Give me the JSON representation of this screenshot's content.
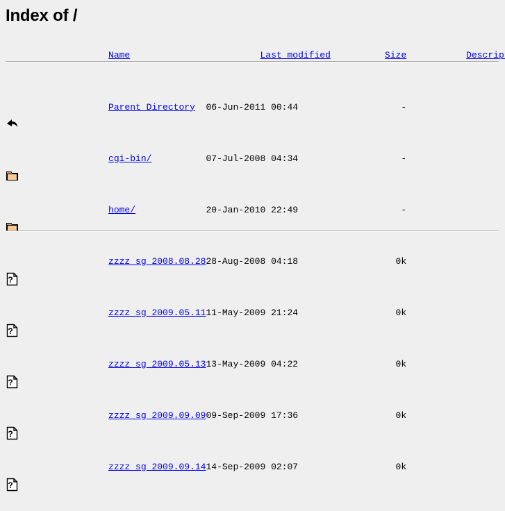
{
  "page": {
    "title": "Index of /"
  },
  "columns": {
    "name": "Name",
    "last_modified": "Last modified",
    "size": "Size",
    "description": "Description"
  },
  "rows": [
    {
      "icon": "back-arrow-icon",
      "name": "Parent Directory",
      "last_modified": "06-Jun-2011 00:44",
      "size": "-",
      "description": ""
    },
    {
      "icon": "folder-icon",
      "name": "cgi-bin/",
      "last_modified": "07-Jul-2008 04:34",
      "size": "-",
      "description": ""
    },
    {
      "icon": "folder-icon",
      "name": "home/",
      "last_modified": "20-Jan-2010 22:49",
      "size": "-",
      "description": ""
    },
    {
      "icon": "unknown-file-icon",
      "name": "zzzz_sg_2008.08.28",
      "last_modified": "28-Aug-2008 04:18",
      "size": "0k",
      "description": ""
    },
    {
      "icon": "unknown-file-icon",
      "name": "zzzz_sg_2009.05.11",
      "last_modified": "11-May-2009 21:24",
      "size": "0k",
      "description": ""
    },
    {
      "icon": "unknown-file-icon",
      "name": "zzzz_sg_2009.05.13",
      "last_modified": "13-May-2009 04:22",
      "size": "0k",
      "description": ""
    },
    {
      "icon": "unknown-file-icon",
      "name": "zzzz_sg_2009.09.09",
      "last_modified": "09-Sep-2009 17:36",
      "size": "0k",
      "description": ""
    },
    {
      "icon": "unknown-file-icon",
      "name": "zzzz_sg_2009.09.14",
      "last_modified": "14-Sep-2009 02:07",
      "size": "0k",
      "description": ""
    }
  ],
  "colors": {
    "background": "#efefef",
    "link": "#0000ee",
    "text": "#000000",
    "rule": "#aaaaaa",
    "folder_face": "#f6c993",
    "folder_edge": "#000000"
  }
}
